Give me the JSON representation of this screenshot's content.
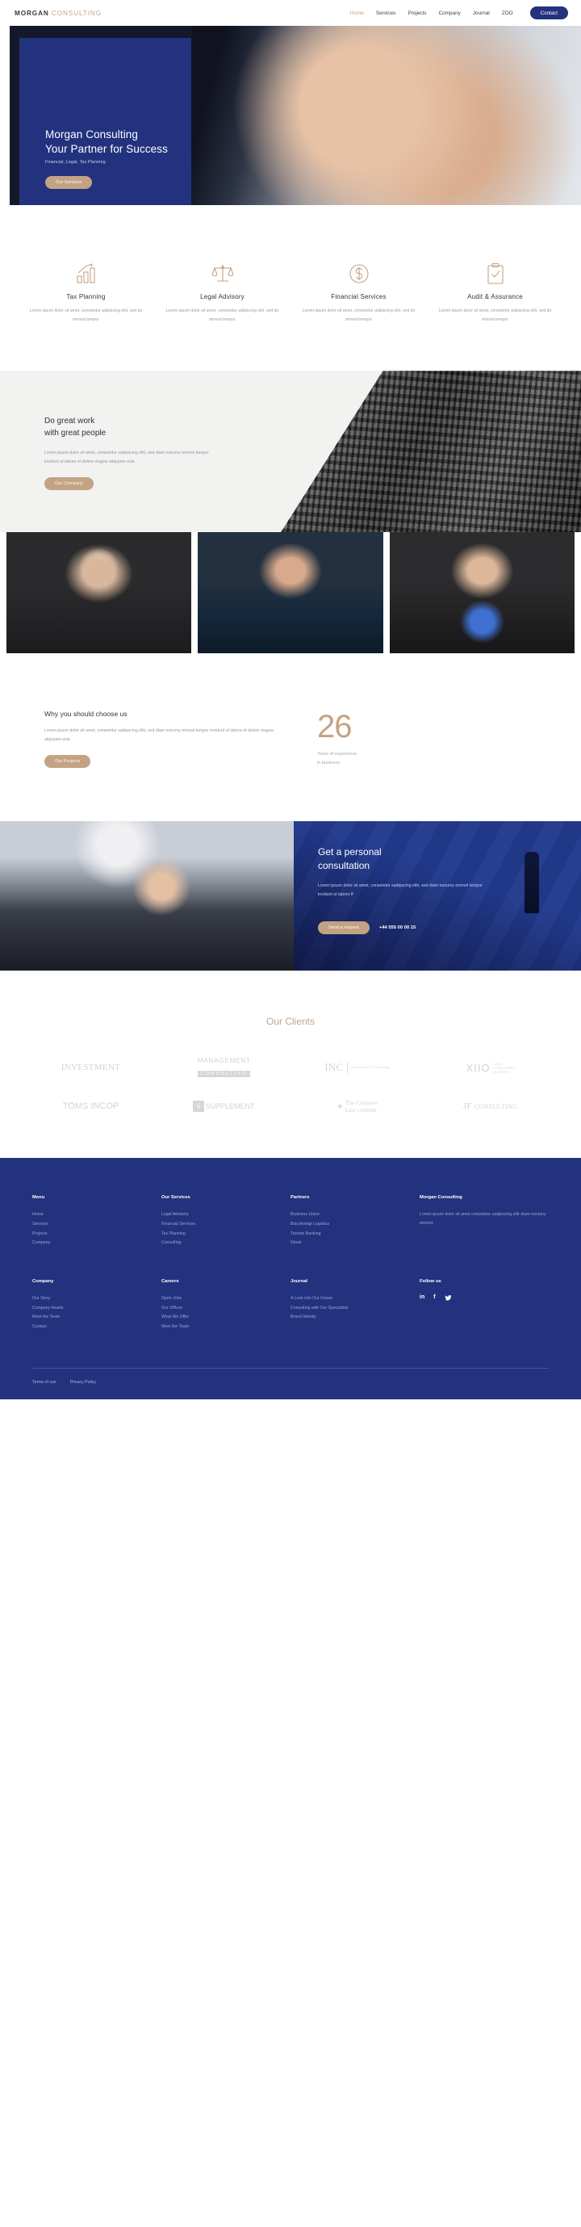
{
  "nav": {
    "logo_bold": "MORGAN",
    "logo_light": "CONSULTING",
    "links": [
      {
        "label": "Home",
        "active": true
      },
      {
        "label": "Services",
        "active": false
      },
      {
        "label": "Projects",
        "active": false
      },
      {
        "label": "Company",
        "active": false
      },
      {
        "label": "Journal",
        "active": false
      },
      {
        "label": "ZOO",
        "active": false
      }
    ],
    "contact_label": "Contact"
  },
  "hero": {
    "title_line1": "Morgan Consulting",
    "title_line2": "Your Partner for Success",
    "subtitle": "Financial, Legal, Tax Planning",
    "cta_label": "Our Services",
    "card_color": "#23327e"
  },
  "services": [
    {
      "icon": "bar-chart-arrow-icon",
      "title": "Tax Planning",
      "desc": "Lorem ipsum dolor sit amet, consetetur adipiscing elitr, sed do eirmod tempor"
    },
    {
      "icon": "scales-balance-icon",
      "title": "Legal Advisory",
      "desc": "Lorem ipsum dolor sit amet, consetetur adipiscing elitr, sed do eirmod tempor"
    },
    {
      "icon": "dollar-coin-icon",
      "title": "Financial Services",
      "desc": "Lorem ipsum dolor sit amet, consetetur adipiscing elitr, sed do eirmod tempor"
    },
    {
      "icon": "clipboard-check-icon",
      "title": "Audit & Assurance",
      "desc": "Lorem ipsum dolor sit amet, consetetur adipiscing elitr, sed do eirmod tempor"
    }
  ],
  "great_work": {
    "title_line1": "Do great work",
    "title_line2": "with great people",
    "paragraph": "Lorem ipsum dolor sit amet, consetetur sadipscing elitr, sed diam nonumy eirmod tempor invidunt ut labore et dolore magna aliquyam erat.",
    "cta_label": "Our Company"
  },
  "team": [
    {
      "name": "team-member-1"
    },
    {
      "name": "team-member-2"
    },
    {
      "name": "team-member-3"
    }
  ],
  "choose": {
    "title": "Why you should choose us",
    "paragraph": "Lorem ipsum dolor sit amet, consetetur sadipscing elitr, sed diam nonumy eirmod tempor invidunt ut labore et dolore magna aliquyam erat.",
    "cta_label": "Our Projects",
    "stat_number": "26",
    "stat_label_line1": "Years of experience",
    "stat_label_line2": "in business"
  },
  "consultation": {
    "title_line1": "Get a personal",
    "title_line2": "consultation",
    "paragraph": "Lorem ipsum dolor sit amet, consetetur sadipscing elitr, sed diam nonumy eirmod tempor invidunt ut labore ff",
    "cta_label": "Send a request",
    "phone": "+44 555 00 00 15"
  },
  "clients": {
    "title_plain": "Our ",
    "title_accent": "Clients",
    "logos": [
      {
        "name": "investment-logo",
        "text": "INVESTMENT"
      },
      {
        "name": "management-consulting-logo",
        "text": "MANAGEMENT",
        "sub": "CONSULTING"
      },
      {
        "name": "inc-investments-logo",
        "text": "INC",
        "sub": "Investments & Consulting"
      },
      {
        "name": "xiio-logo",
        "text": "XIIO",
        "sub": "XTAA CONSULTING BUSINESS"
      },
      {
        "name": "toms-incop-logo",
        "text": "TOMS INCOP"
      },
      {
        "name": "supplement-logo",
        "text": "S",
        "sub": "SUPPLEMENT"
      },
      {
        "name": "crosswo-law-logo",
        "text": "The Crosswo",
        "sub": "Law confirm"
      },
      {
        "name": "jf-consulting-logo",
        "text": "JF",
        "sub": "CONSULTING"
      }
    ]
  },
  "footer": {
    "columns_row1": [
      {
        "heading": "Menu",
        "items": [
          "Home",
          "Services",
          "Projects",
          "Company"
        ]
      },
      {
        "heading": "Our Services",
        "items": [
          "Legal Advisory",
          "Financial Services",
          "Tax Planning",
          "Consulting"
        ]
      },
      {
        "heading": "Partners",
        "items": [
          "Business Union",
          "Biscottologi Logistics",
          "Toronto Banking",
          "Ninoé"
        ]
      },
      {
        "heading": "Morgan Consulting",
        "items": [
          "Lorem ipsum dolor sit amet consetetur sadipscing elitr diam nonumy eirmod."
        ]
      }
    ],
    "columns_row2": [
      {
        "heading": "Company",
        "items": [
          "Our Story",
          "Company Heads",
          "Meet the Team",
          "Contact"
        ]
      },
      {
        "heading": "Careers",
        "items": [
          "Open Jobs",
          "Our Offices",
          "What We Offer",
          "Meet the Team"
        ]
      },
      {
        "heading": "Journal",
        "items": [
          "A Look into Our Future",
          "Consulting with Our Specialists",
          "Brand Identity"
        ]
      },
      {
        "heading": "Follow us",
        "items": []
      }
    ],
    "social": [
      {
        "name": "linkedin-icon",
        "glyph": "in"
      },
      {
        "name": "facebook-icon",
        "glyph": "f"
      },
      {
        "name": "twitter-icon",
        "glyph": "🐦"
      }
    ],
    "legal": [
      "Terms of use",
      "Privacy Policy"
    ]
  }
}
